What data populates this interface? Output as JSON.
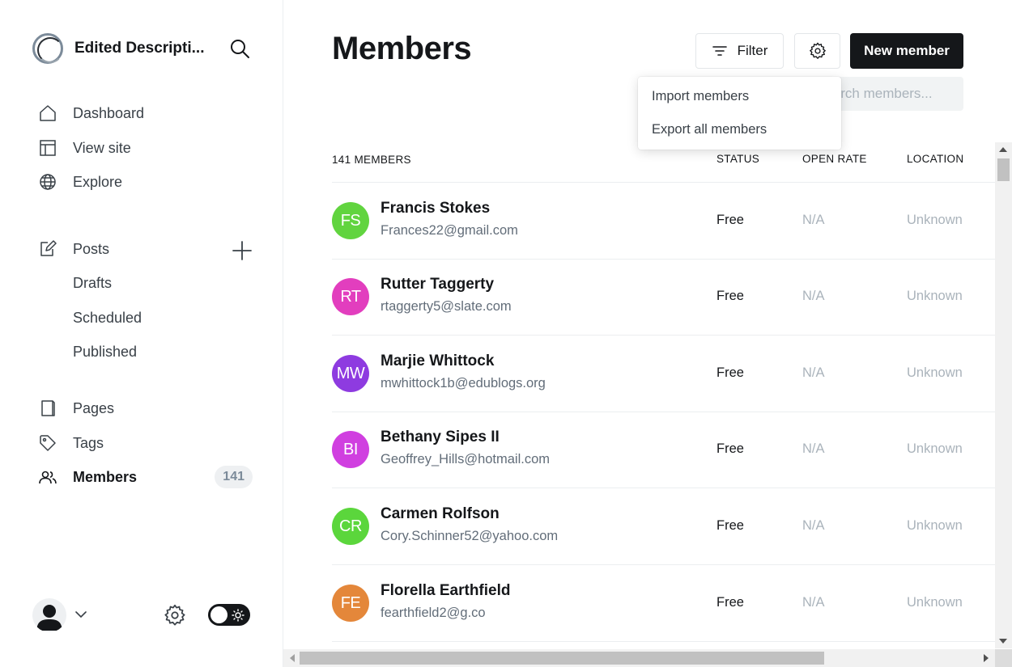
{
  "sidebar": {
    "site_name": "Edited Descripti...",
    "nav": [
      {
        "label": "Dashboard",
        "icon": "home-icon"
      },
      {
        "label": "View site",
        "icon": "layout-icon"
      },
      {
        "label": "Explore",
        "icon": "globe-icon"
      }
    ],
    "posts": {
      "label": "Posts",
      "icon": "edit-icon",
      "sub": [
        "Drafts",
        "Scheduled",
        "Published"
      ]
    },
    "pages_label": "Pages",
    "tags_label": "Tags",
    "members_label": "Members",
    "members_count": "141"
  },
  "header": {
    "title": "Members",
    "filter_label": "Filter",
    "new_member_label": "New member",
    "search_placeholder": "Search members..."
  },
  "dropdown": {
    "import_label": "Import members",
    "export_label": "Export all members"
  },
  "table": {
    "count_header": "141 MEMBERS",
    "status_header": "STATUS",
    "open_rate_header": "OPEN RATE",
    "location_header": "LOCATION",
    "rows": [
      {
        "initials": "FS",
        "color": "#61d43f",
        "name": "Francis Stokes",
        "email": "Frances22@gmail.com",
        "status": "Free",
        "open_rate": "N/A",
        "location": "Unknown"
      },
      {
        "initials": "RT",
        "color": "#e23ebe",
        "name": "Rutter Taggerty",
        "email": "rtaggerty5@slate.com",
        "status": "Free",
        "open_rate": "N/A",
        "location": "Unknown"
      },
      {
        "initials": "MW",
        "color": "#8e3be0",
        "name": "Marjie Whittock",
        "email": "mwhittock1b@edublogs.org",
        "status": "Free",
        "open_rate": "N/A",
        "location": "Unknown"
      },
      {
        "initials": "BI",
        "color": "#d03fe0",
        "name": "Bethany Sipes II",
        "email": "Geoffrey_Hills@hotmail.com",
        "status": "Free",
        "open_rate": "N/A",
        "location": "Unknown"
      },
      {
        "initials": "CR",
        "color": "#5bd63c",
        "name": "Carmen Rolfson",
        "email": "Cory.Schinner52@yahoo.com",
        "status": "Free",
        "open_rate": "N/A",
        "location": "Unknown"
      },
      {
        "initials": "FE",
        "color": "#e4873a",
        "name": "Florella Earthfield",
        "email": "fearthfield2@g.co",
        "status": "Free",
        "open_rate": "N/A",
        "location": "Unknown"
      }
    ]
  }
}
